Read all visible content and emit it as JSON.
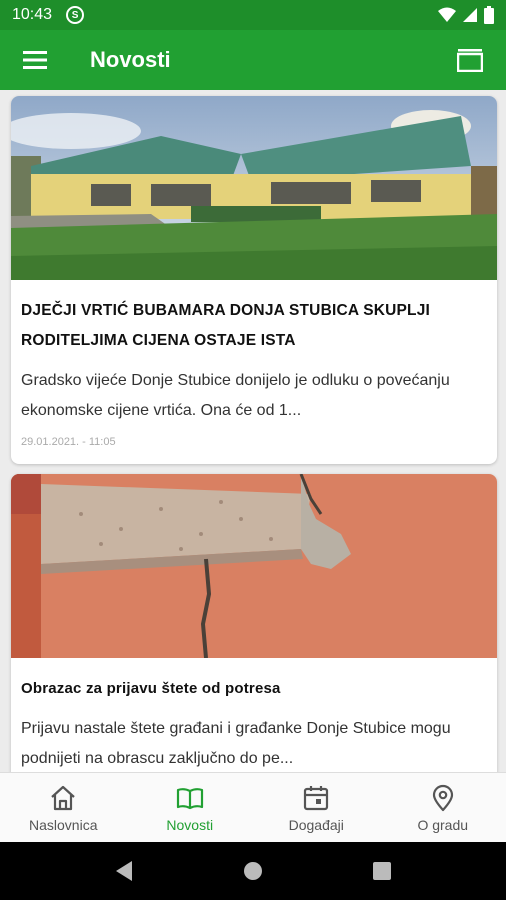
{
  "status_bar": {
    "time": "10:43",
    "sync_glyph": "S"
  },
  "app_bar": {
    "title": "Novosti"
  },
  "colors": {
    "primary": "#21a032",
    "status_bar": "#1e8e2a"
  },
  "feed": {
    "cards": [
      {
        "title": "DJEČJI VRTIĆ BUBAMARA DONJA STUBICA SKUPLJI RODITELJIMA CIJENA OSTAJE ISTA",
        "excerpt": "Gradsko vijeće Donje Stubice donijelo je odluku o povećanju ekonomske cijene vrtića. Ona će od 1...",
        "date": "29.01.2021. - 11:05",
        "image": "kindergarten-building-photo"
      },
      {
        "title": "Obrazac za prijavu štete od potresa",
        "excerpt": "Prijavu nastale štete građani i građanke Donje Stubice mogu podnijeti na obrascu zaključno do pe...",
        "image": "cracked-wall-photo"
      }
    ]
  },
  "bottom_nav": {
    "items": [
      {
        "label": "Naslovnica",
        "icon": "home-icon"
      },
      {
        "label": "Novosti",
        "icon": "book-icon",
        "active": true
      },
      {
        "label": "Događaji",
        "icon": "calendar-icon"
      },
      {
        "label": "O gradu",
        "icon": "location-pin-icon"
      }
    ]
  }
}
